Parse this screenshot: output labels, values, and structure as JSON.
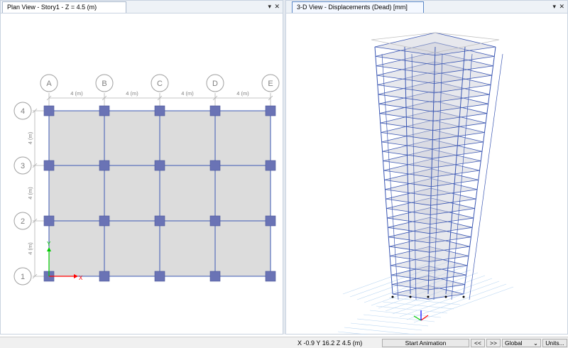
{
  "left_view": {
    "title": "Plan View - Story1 - Z = 4.5 (m)",
    "pin_icon": "pin-icon",
    "close_icon": "close-icon",
    "grid_x": [
      "A",
      "B",
      "C",
      "D",
      "E"
    ],
    "grid_y": [
      "1",
      "2",
      "3",
      "4"
    ],
    "x_spacing_labels": [
      "4 (m)",
      "4 (m)",
      "4 (m)",
      "4 (m)"
    ],
    "y_spacing_labels": [
      "4 (m)",
      "4 (m)",
      "4 (m)"
    ],
    "axis_x_label": "X",
    "axis_y_label": "Y"
  },
  "right_view": {
    "title": "3-D View  - Displacements (Dead)  [mm]",
    "pin_icon": "pin-icon",
    "close_icon": "close-icon"
  },
  "statusbar": {
    "coords": "X -0.9  Y 16.2  Z 4.5 (m)",
    "start_animation": "Start Animation",
    "prev": "<<",
    "next": ">>",
    "coord_system": "Global",
    "units": "Units..."
  },
  "colors": {
    "frame": "#3b57b3",
    "column": "#6a73b5",
    "slab": "#dcdcdc",
    "gridline": "#b0b0b0",
    "axis_x": "#ff0000",
    "axis_y": "#00cc00"
  }
}
